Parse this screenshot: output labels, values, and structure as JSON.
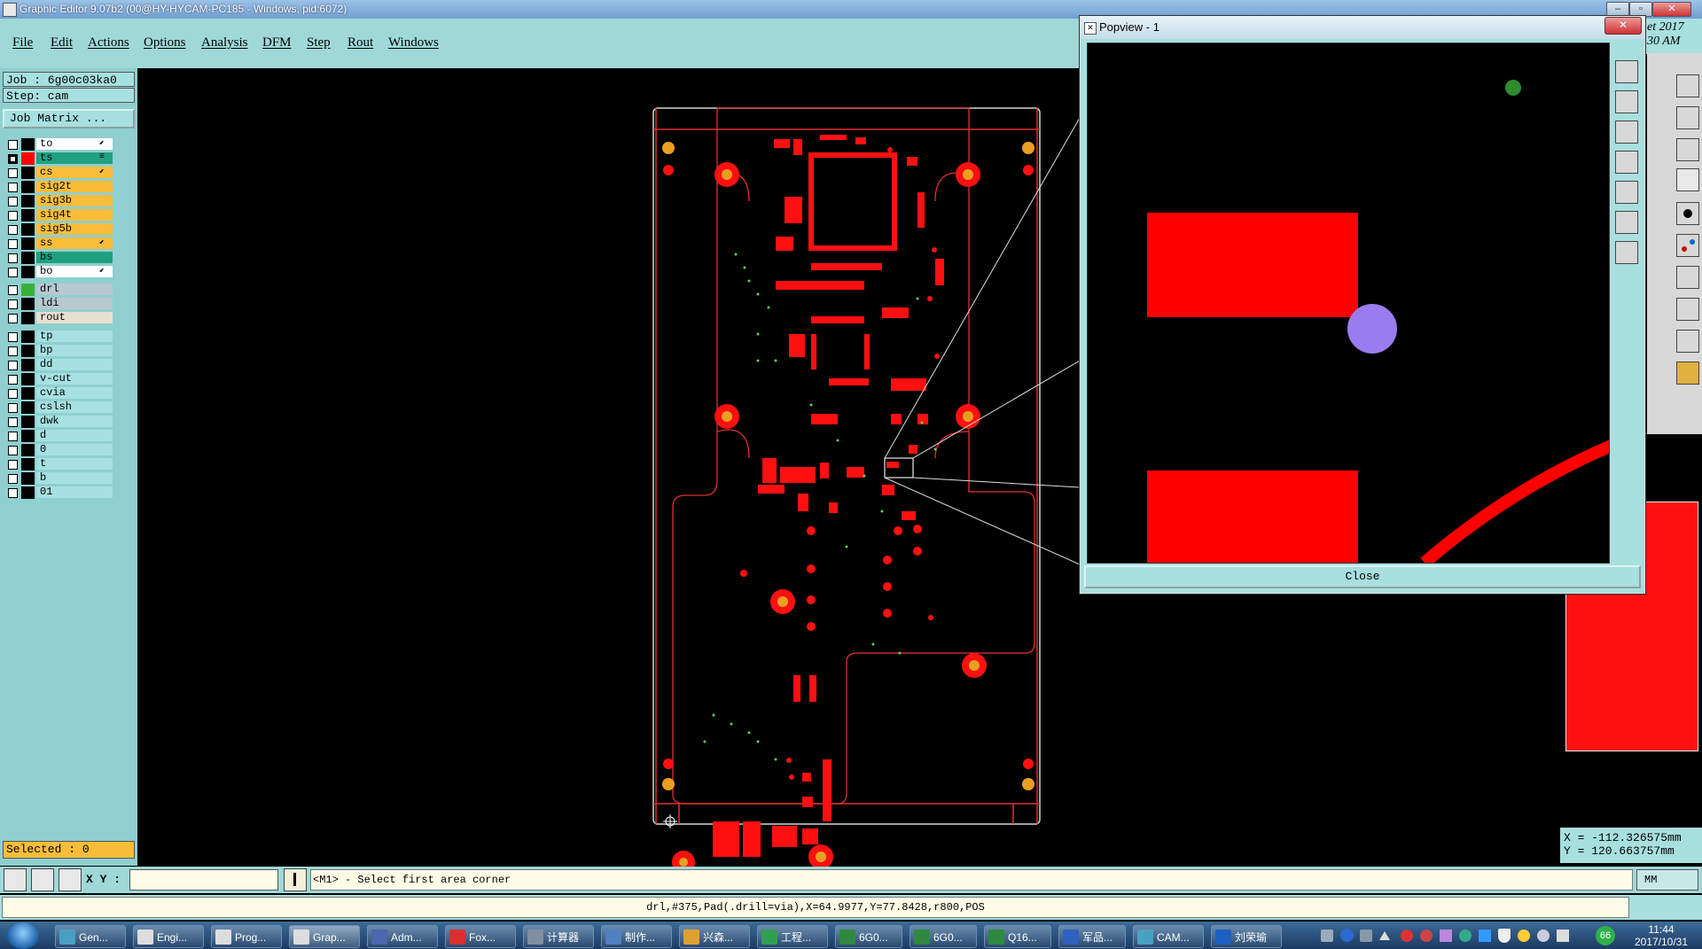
{
  "window": {
    "title": "Graphic Editor 9.07b2 (00@HY-HYCAM-PC185 - Windows, pid:6072)",
    "min_label": "–",
    "max_label": "▫",
    "close_label": "✕"
  },
  "menu": [
    "File",
    "Edit",
    "Actions",
    "Options",
    "Analysis",
    "DFM",
    "Step",
    "Rout",
    "Windows"
  ],
  "job": {
    "job_label": "Job : 6g00c03ka0",
    "step_label": "Step: cam",
    "matrix_button": "Job Matrix ..."
  },
  "layers_group1": [
    {
      "name": "to",
      "color": "#ffffff",
      "mark": "⬋"
    },
    {
      "name": "ts",
      "color": "#20a080",
      "mark": "≡"
    },
    {
      "name": "cs",
      "color": "#f9bd3a",
      "mark": "⬋"
    },
    {
      "name": "sig2t",
      "color": "#f9bd3a",
      "mark": ""
    },
    {
      "name": "sig3b",
      "color": "#f9bd3a",
      "mark": ""
    },
    {
      "name": "sig4t",
      "color": "#f9bd3a",
      "mark": ""
    },
    {
      "name": "sig5b",
      "color": "#f9bd3a",
      "mark": ""
    },
    {
      "name": "ss",
      "color": "#f9bd3a",
      "mark": "⬋"
    },
    {
      "name": "bs",
      "color": "#20a080",
      "mark": ""
    },
    {
      "name": "bo",
      "color": "#ffffff",
      "mark": "⬋"
    }
  ],
  "layers_group2": [
    {
      "name": "drl",
      "color": "#b8c8d0"
    },
    {
      "name": "ldi",
      "color": "#b8c8d0"
    },
    {
      "name": "rout",
      "color": "#e8e0d0"
    }
  ],
  "layers_group3": [
    {
      "name": "tp"
    },
    {
      "name": "bp"
    },
    {
      "name": "dd"
    },
    {
      "name": "v-cut"
    },
    {
      "name": "cvia"
    },
    {
      "name": "cslsh"
    },
    {
      "name": "dwk"
    },
    {
      "name": "d"
    },
    {
      "name": "0"
    },
    {
      "name": "t"
    },
    {
      "name": "b"
    },
    {
      "name": "01"
    }
  ],
  "selected_label": "Selected : 0",
  "xy_label": "X Y :",
  "xy_input_value": "",
  "prompt": "<M1> - Select first area corner",
  "info_line": "drl,#375,Pad(.drill=via),X=64.9977,Y=77.8428,r800,POS",
  "coords": {
    "x": "X = -112.326575mm",
    "y": "Y = 120.663757mm"
  },
  "units_button": "MM",
  "popview": {
    "title": "Popview - 1",
    "close_button": "Close",
    "close_icon": "✕"
  },
  "bg_fragment": {
    "date": "et 2017",
    "time": "30 AM"
  },
  "taskbar": {
    "items": [
      {
        "label": "Gen...",
        "color": "#4aa0c0"
      },
      {
        "label": "Engi...",
        "color": "#dddddd"
      },
      {
        "label": "Prog...",
        "color": "#dddddd"
      },
      {
        "label": "Grap...",
        "color": "#dddddd"
      },
      {
        "label": "Adm...",
        "color": "#4c66b0"
      },
      {
        "label": "Fox...",
        "color": "#d83030"
      },
      {
        "label": "计算器",
        "color": "#8090a0"
      },
      {
        "label": "制作...",
        "color": "#5080c0"
      },
      {
        "label": "兴森...",
        "color": "#e0a030"
      },
      {
        "label": "工程...",
        "color": "#30a050"
      },
      {
        "label": "6G0...",
        "color": "#2f8a3f"
      },
      {
        "label": "6G0...",
        "color": "#2f8a3f"
      },
      {
        "label": "Q16...",
        "color": "#2f8a3f"
      },
      {
        "label": "军品...",
        "color": "#3060c0"
      },
      {
        "label": "CAM...",
        "color": "#4aa0c0"
      },
      {
        "label": "刘荣瑜",
        "color": "#1e60c0"
      }
    ],
    "tray_badge": "66",
    "time": "11:44",
    "date": "2017/10/31"
  },
  "colors": {
    "board_outline": "#e03030",
    "pad_red": "#ff1010",
    "pad_orange": "#e8a020",
    "drill_green": "#58d058",
    "zoom_pad": "#ff0000",
    "zoom_circle": "#9a7cf0",
    "panel_cyan": "#a0d8d8"
  }
}
